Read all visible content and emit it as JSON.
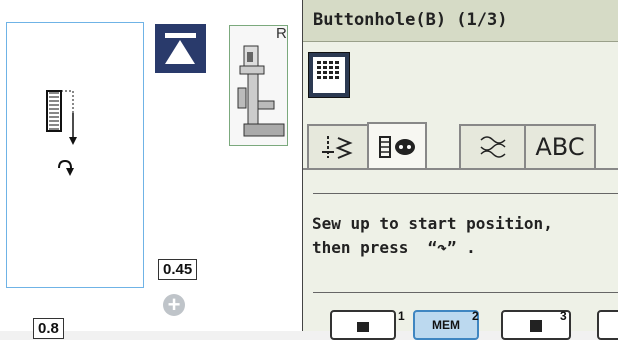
{
  "left": {
    "foot_letter": "R",
    "stitch_width": "0.45",
    "stitch_length": "0.8",
    "plus_label": "+"
  },
  "header": {
    "title": "Buttonhole(B) (1/3)"
  },
  "tabs": [
    {
      "name": "utility-stitch-tab",
      "icon": "utility-stitch-icon"
    },
    {
      "name": "buttonhole-tab",
      "icon": "buttonhole-icon",
      "active": true
    },
    {
      "name": "decorative-stitch-tab",
      "icon": "decorative-stitch-icon"
    },
    {
      "name": "alphabet-tab",
      "label": "ABC"
    }
  ],
  "message": {
    "line1": "Sew up to start position,",
    "line2": "then press  “↷” ."
  },
  "memory": [
    {
      "label": "",
      "num": "1"
    },
    {
      "label": "MEM",
      "num": "2",
      "selected": true
    },
    {
      "label": "",
      "num": "3"
    }
  ],
  "colors": {
    "accent": "#293a6b",
    "selected": "#bcd9ef",
    "preview_border": "#6fb3e6"
  }
}
